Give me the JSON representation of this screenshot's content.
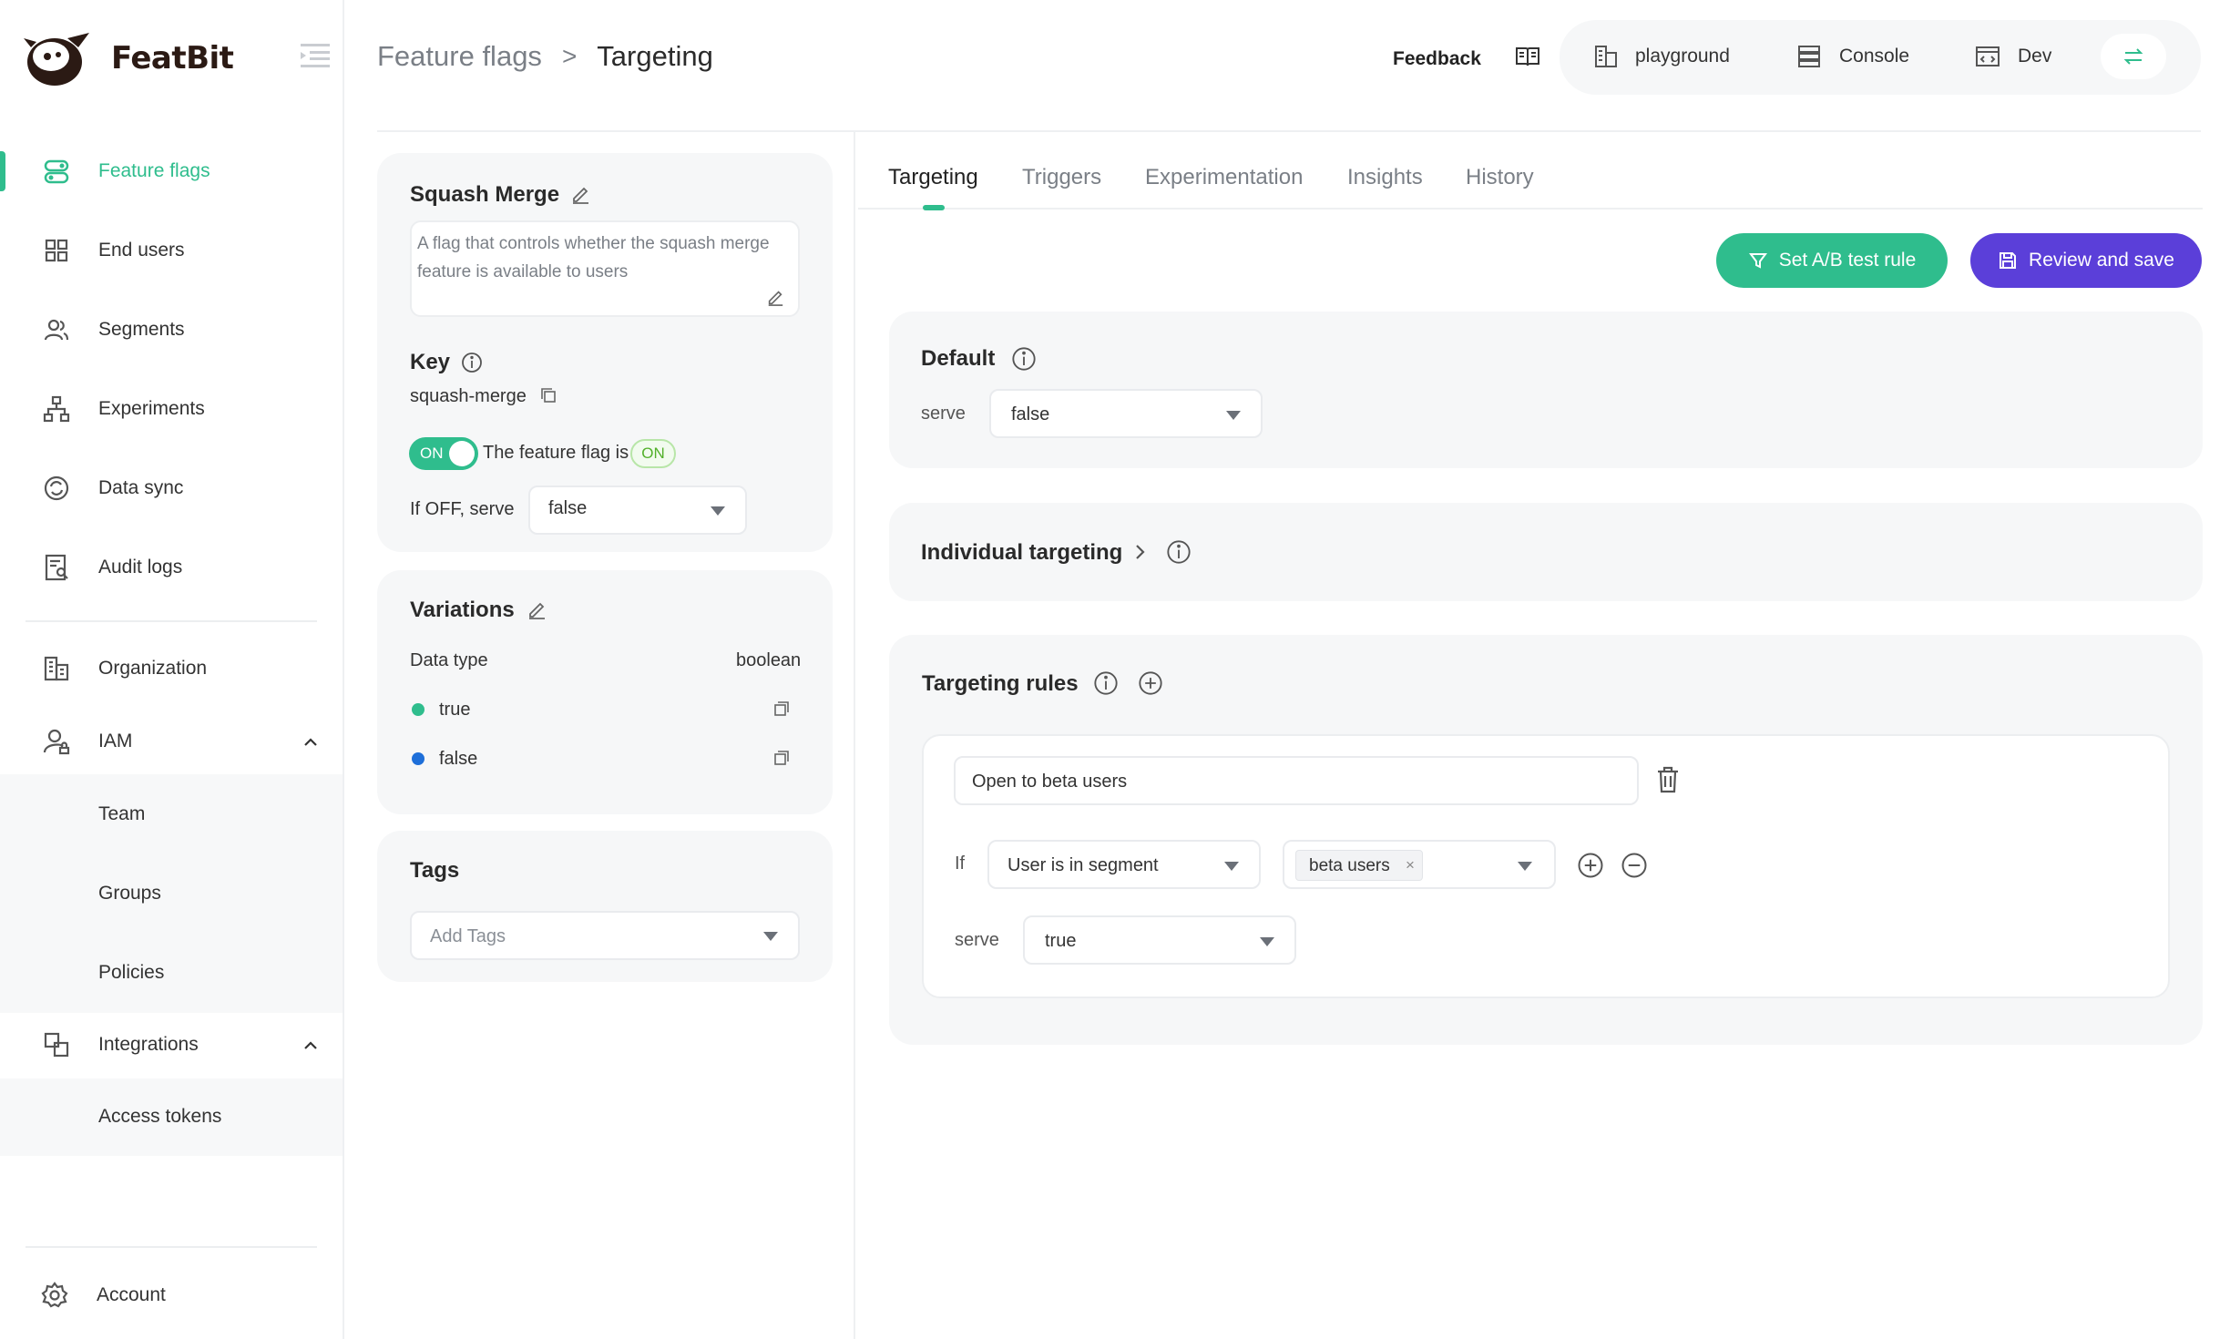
{
  "app": {
    "name": "FeatBit"
  },
  "sidebar": {
    "items": [
      {
        "label": "Feature flags",
        "icon": "toggle-icon",
        "active": true
      },
      {
        "label": "End users",
        "icon": "grid-icon"
      },
      {
        "label": "Segments",
        "icon": "users-icon"
      },
      {
        "label": "Experiments",
        "icon": "hierarchy-icon"
      },
      {
        "label": "Data sync",
        "icon": "sync-icon"
      },
      {
        "label": "Audit logs",
        "icon": "audit-icon"
      },
      {
        "label": "Organization",
        "icon": "building-icon"
      },
      {
        "label": "IAM",
        "icon": "user-lock-icon",
        "expanded": true
      },
      {
        "label": "Team"
      },
      {
        "label": "Groups"
      },
      {
        "label": "Policies"
      },
      {
        "label": "Integrations",
        "icon": "integration-icon",
        "expanded": true
      },
      {
        "label": "Access tokens"
      },
      {
        "label": "Account",
        "icon": "gear-icon"
      }
    ]
  },
  "header": {
    "breadcrumb": {
      "parent": "Feature flags",
      "separator": ">",
      "current": "Targeting"
    },
    "feedback_label": "Feedback",
    "env": {
      "project": "playground",
      "console": "Console",
      "environment": "Dev"
    }
  },
  "flag": {
    "name": "Squash Merge",
    "description": "A flag that controls whether the squash merge feature is available to users",
    "key_label": "Key",
    "key": "squash-merge",
    "toggle_label": "ON",
    "status_text": "The feature flag is",
    "status_badge": "ON",
    "off_serve_label": "If OFF, serve",
    "off_serve_value": "false"
  },
  "variations": {
    "title": "Variations",
    "data_type_label": "Data type",
    "data_type": "boolean",
    "items": [
      {
        "value": "true",
        "color": "#2fbd8d"
      },
      {
        "value": "false",
        "color": "#1e6fd9"
      }
    ]
  },
  "tags": {
    "title": "Tags",
    "placeholder": "Add Tags"
  },
  "tabs": [
    "Targeting",
    "Triggers",
    "Experimentation",
    "Insights",
    "History"
  ],
  "actions": {
    "ab_test": "Set A/B test rule",
    "review_save": "Review and save"
  },
  "default_rule": {
    "title": "Default",
    "serve_label": "serve",
    "serve_value": "false"
  },
  "individual_targeting": {
    "title": "Individual targeting"
  },
  "targeting_rules": {
    "title": "Targeting rules",
    "rules": [
      {
        "name": "Open to beta users",
        "if_label": "If",
        "condition": "User is in segment",
        "segments": [
          "beta users"
        ],
        "serve_label": "serve",
        "serve_value": "true"
      }
    ]
  },
  "colors": {
    "accent": "#2fbd8d",
    "primary": "#5b3fd9"
  }
}
